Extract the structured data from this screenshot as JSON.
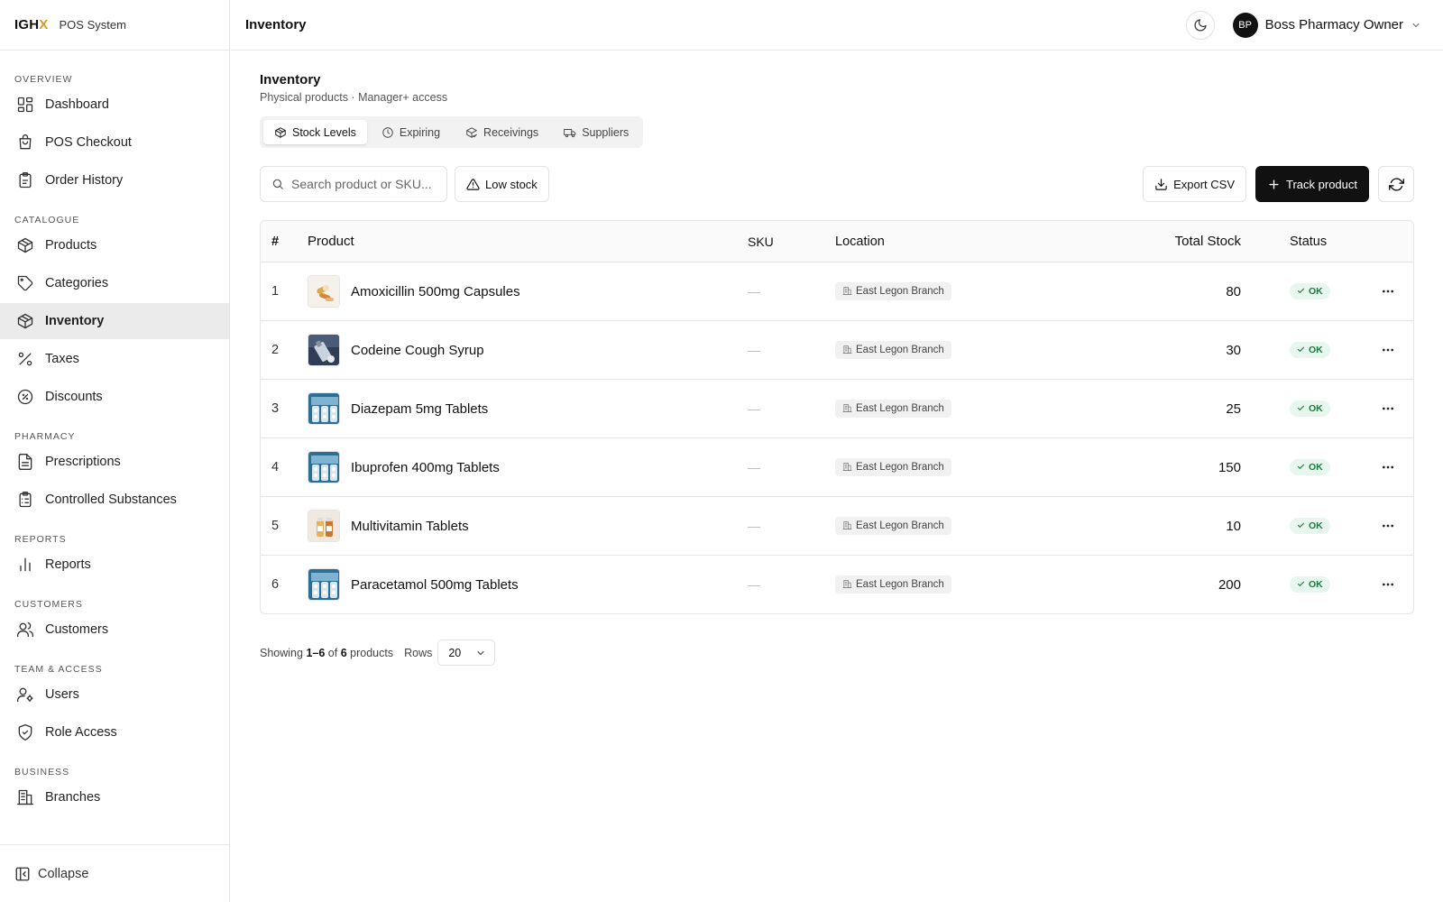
{
  "brand": {
    "logo_main": "IGH",
    "logo_accent": "X",
    "system_label": "POS System"
  },
  "sidebar": {
    "groups": [
      {
        "label": "OVERVIEW",
        "items": [
          {
            "label": "Dashboard",
            "icon": "dashboard-icon"
          },
          {
            "label": "POS Checkout",
            "icon": "shopping-bag-icon"
          },
          {
            "label": "Order History",
            "icon": "clipboard-icon"
          }
        ]
      },
      {
        "label": "CATALOGUE",
        "items": [
          {
            "label": "Products",
            "icon": "box-icon"
          },
          {
            "label": "Categories",
            "icon": "tag-icon"
          },
          {
            "label": "Inventory",
            "icon": "package-icon",
            "active": true
          },
          {
            "label": "Taxes",
            "icon": "percent-icon"
          },
          {
            "label": "Discounts",
            "icon": "discount-badge-icon"
          }
        ]
      },
      {
        "label": "PHARMACY",
        "items": [
          {
            "label": "Prescriptions",
            "icon": "file-text-icon"
          },
          {
            "label": "Controlled Substances",
            "icon": "clipboard-list-icon"
          }
        ]
      },
      {
        "label": "REPORTS",
        "items": [
          {
            "label": "Reports",
            "icon": "bar-chart-icon"
          }
        ]
      },
      {
        "label": "CUSTOMERS",
        "items": [
          {
            "label": "Customers",
            "icon": "users-icon"
          }
        ]
      },
      {
        "label": "TEAM & ACCESS",
        "items": [
          {
            "label": "Users",
            "icon": "user-cog-icon"
          },
          {
            "label": "Role Access",
            "icon": "shield-check-icon"
          }
        ]
      },
      {
        "label": "BUSINESS",
        "items": [
          {
            "label": "Branches",
            "icon": "building-icon"
          }
        ]
      }
    ],
    "collapse_label": "Collapse"
  },
  "topbar": {
    "title": "Inventory",
    "user_initials": "BP",
    "user_name": "Boss Pharmacy Owner"
  },
  "page": {
    "title": "Inventory",
    "subtitle": "Physical products · Manager+ access",
    "tabs": [
      {
        "label": "Stock Levels",
        "icon": "package-icon",
        "active": true
      },
      {
        "label": "Expiring",
        "icon": "clock-icon"
      },
      {
        "label": "Receivings",
        "icon": "package-check-icon"
      },
      {
        "label": "Suppliers",
        "icon": "truck-icon"
      }
    ]
  },
  "toolbar": {
    "search_placeholder": "Search product or SKU...",
    "low_stock_label": "Low stock",
    "export_label": "Export CSV",
    "track_label": "Track product"
  },
  "table": {
    "headers": {
      "num": "#",
      "product": "Product",
      "sku": "SKU",
      "location": "Location",
      "stock": "Total Stock",
      "status": "Status"
    },
    "rows": [
      {
        "num": "1",
        "product": "Amoxicillin 500mg Capsules",
        "sku": "—",
        "location": "East Legon Branch",
        "stock": "80",
        "status": "OK",
        "thumb": "capsules"
      },
      {
        "num": "2",
        "product": "Codeine Cough Syrup",
        "sku": "—",
        "location": "East Legon Branch",
        "stock": "30",
        "status": "OK",
        "thumb": "syrup"
      },
      {
        "num": "3",
        "product": "Diazepam 5mg Tablets",
        "sku": "—",
        "location": "East Legon Branch",
        "stock": "25",
        "status": "OK",
        "thumb": "blister"
      },
      {
        "num": "4",
        "product": "Ibuprofen 400mg Tablets",
        "sku": "—",
        "location": "East Legon Branch",
        "stock": "150",
        "status": "OK",
        "thumb": "blister"
      },
      {
        "num": "5",
        "product": "Multivitamin Tablets",
        "sku": "—",
        "location": "East Legon Branch",
        "stock": "10",
        "status": "OK",
        "thumb": "bottles"
      },
      {
        "num": "6",
        "product": "Paracetamol 500mg Tablets",
        "sku": "—",
        "location": "East Legon Branch",
        "stock": "200",
        "status": "OK",
        "thumb": "blister"
      }
    ]
  },
  "pagination": {
    "showing_prefix": "Showing",
    "range": "1–6",
    "of": "of",
    "total": "6",
    "suffix": "products",
    "rows_label": "Rows",
    "rows_value": "20"
  }
}
